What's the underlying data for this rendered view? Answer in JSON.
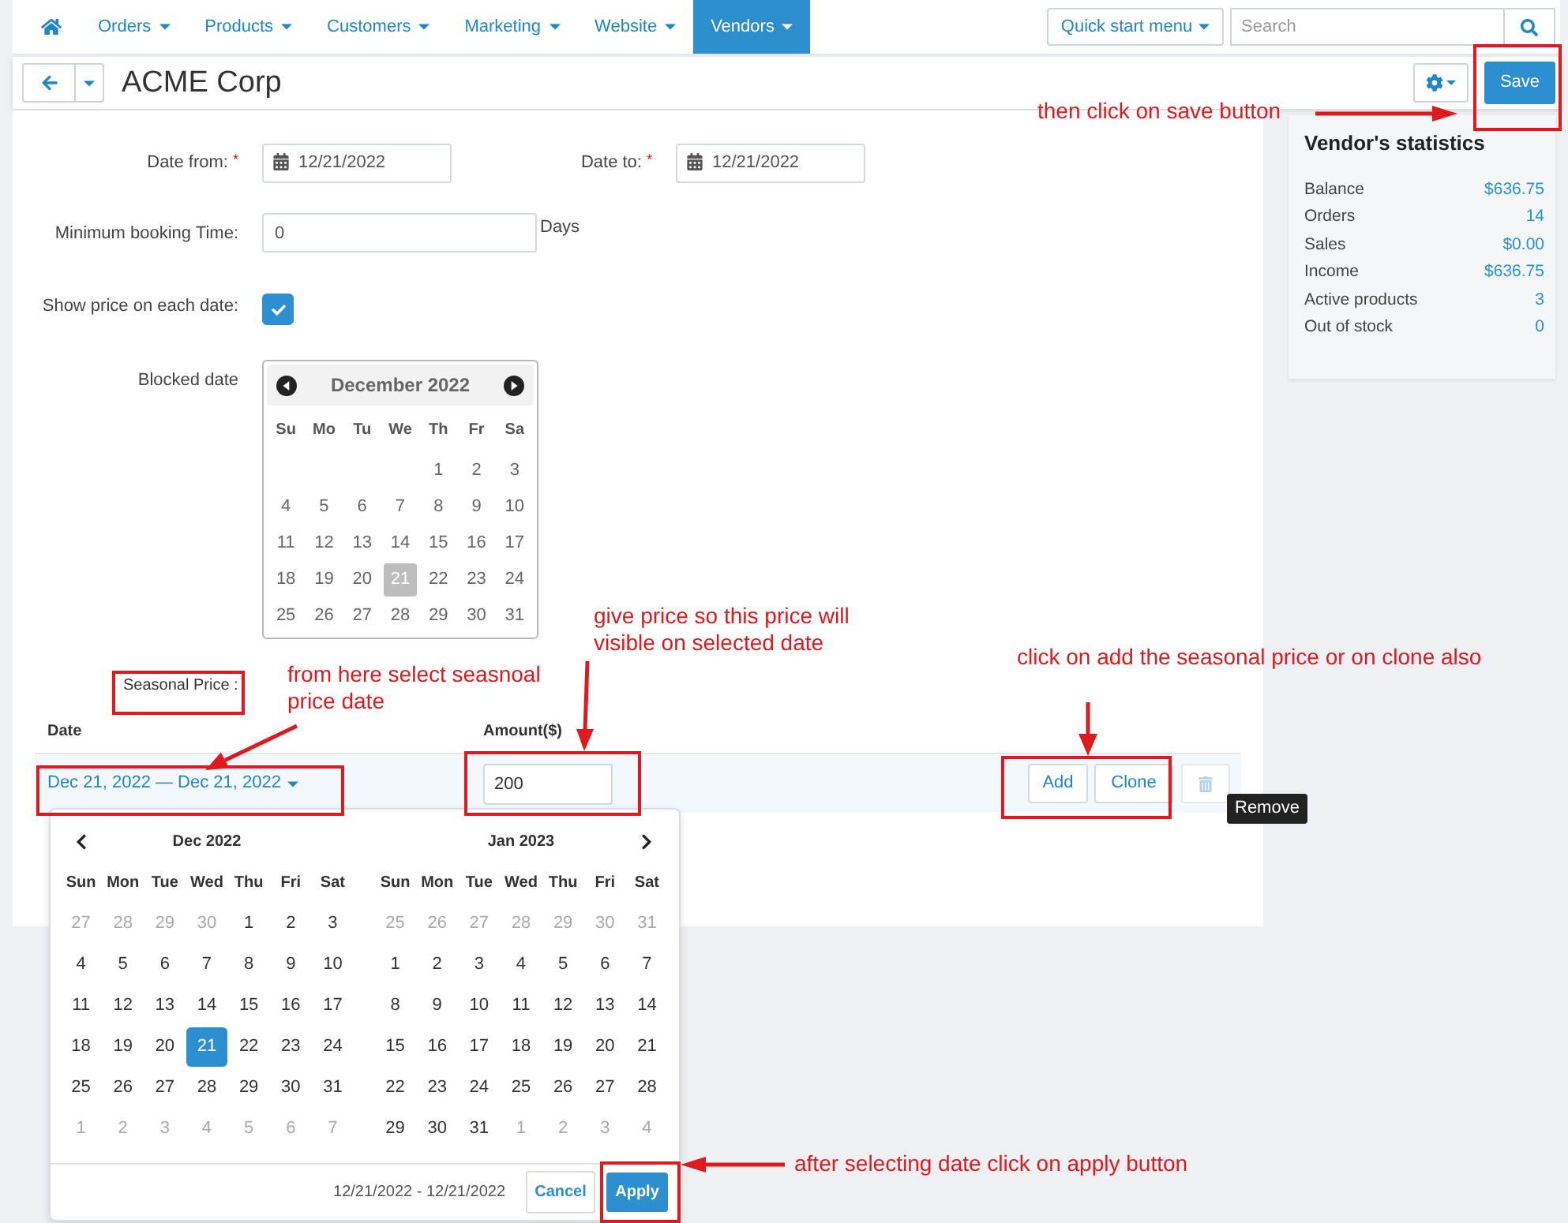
{
  "top_nav": {
    "items": [
      {
        "label": "Orders",
        "selected": false
      },
      {
        "label": "Products",
        "selected": false
      },
      {
        "label": "Customers",
        "selected": false
      },
      {
        "label": "Marketing",
        "selected": false
      },
      {
        "label": "Website",
        "selected": false
      },
      {
        "label": "Vendors",
        "selected": true
      }
    ],
    "quick_start": "Quick start menu",
    "search": {
      "placeholder": "Search"
    }
  },
  "toolbar": {
    "title": "ACME Corp",
    "save_button": "Save"
  },
  "form": {
    "date_from": {
      "label": "Date from:",
      "required_mark": "*",
      "value": "12/21/2022"
    },
    "date_to": {
      "label": "Date to:",
      "required_mark": "*",
      "value": "12/21/2022"
    },
    "min_booking": {
      "label": "Minimum booking Time:",
      "value": "0",
      "unit": "Days"
    },
    "show_price": {
      "label": "Show price on each date:",
      "checked": true
    },
    "blocked_date": {
      "label": "Blocked date",
      "calendar": {
        "title": "December 2022",
        "weekdays": [
          "Su",
          "Mo",
          "Tu",
          "We",
          "Th",
          "Fr",
          "Sa"
        ],
        "weeks": [
          [
            {
              "day": "1",
              "selected": false
            },
            {
              "day": "2",
              "selected": false
            },
            {
              "day": "3",
              "selected": false
            }
          ],
          [
            {
              "day": "4",
              "selected": false
            },
            {
              "day": "5",
              "selected": false
            },
            {
              "day": "6",
              "selected": false
            },
            {
              "day": "7",
              "selected": false
            },
            {
              "day": "8",
              "selected": false
            },
            {
              "day": "9",
              "selected": false
            },
            {
              "day": "10",
              "selected": false
            }
          ],
          [
            {
              "day": "11",
              "selected": false
            },
            {
              "day": "12",
              "selected": false
            },
            {
              "day": "13",
              "selected": false
            },
            {
              "day": "14",
              "selected": false
            },
            {
              "day": "15",
              "selected": false
            },
            {
              "day": "16",
              "selected": false
            },
            {
              "day": "17",
              "selected": false
            }
          ],
          [
            {
              "day": "18",
              "selected": false
            },
            {
              "day": "19",
              "selected": false
            },
            {
              "day": "20",
              "selected": false
            },
            {
              "day": "21",
              "selected": true
            },
            {
              "day": "22",
              "selected": false
            },
            {
              "day": "23",
              "selected": false
            },
            {
              "day": "24",
              "selected": false
            }
          ],
          [
            {
              "day": "25",
              "selected": false
            },
            {
              "day": "26",
              "selected": false
            },
            {
              "day": "27",
              "selected": false
            },
            {
              "day": "28",
              "selected": false
            },
            {
              "day": "29",
              "selected": false
            },
            {
              "day": "30",
              "selected": false
            },
            {
              "day": "31",
              "selected": false
            }
          ]
        ]
      }
    }
  },
  "stats": {
    "title": "Vendor's statistics",
    "rows": [
      {
        "label": "Balance",
        "value": "$636.75"
      },
      {
        "label": "Orders",
        "value": "14"
      },
      {
        "label": "Sales",
        "value": "$0.00"
      },
      {
        "label": "Income",
        "value": "$636.75"
      },
      {
        "label": "Active products",
        "value": "3"
      },
      {
        "label": "Out of stock",
        "value": "0"
      }
    ]
  },
  "seasonal_price": {
    "label": "Seasonal Price :",
    "columns": [
      "Date",
      "Amount($)"
    ],
    "rows": [
      {
        "date_range": "Dec 21, 2022 — Dec 21, 2022",
        "amount": "200",
        "buttons": [
          "Add",
          "Clone"
        ],
        "remove_tooltip": "Remove"
      }
    ]
  },
  "date_range_picker": {
    "months": [
      {
        "title": "Dec 2022",
        "weekdays": [
          "Sun",
          "Mon",
          "Tue",
          "Wed",
          "Thu",
          "Fri",
          "Sat"
        ],
        "weeks": [
          [
            {
              "day": "27",
              "muted": true,
              "selected": false
            },
            {
              "day": "28",
              "muted": true,
              "selected": false
            },
            {
              "day": "29",
              "muted": true,
              "selected": false
            },
            {
              "day": "30",
              "muted": true,
              "selected": false
            },
            {
              "day": "1",
              "muted": false,
              "selected": false
            },
            {
              "day": "2",
              "muted": false,
              "selected": false
            },
            {
              "day": "3",
              "muted": false,
              "selected": false
            }
          ],
          [
            {
              "day": "4",
              "muted": false,
              "selected": false
            },
            {
              "day": "5",
              "muted": false,
              "selected": false
            },
            {
              "day": "6",
              "muted": false,
              "selected": false
            },
            {
              "day": "7",
              "muted": false,
              "selected": false
            },
            {
              "day": "8",
              "muted": false,
              "selected": false
            },
            {
              "day": "9",
              "muted": false,
              "selected": false
            },
            {
              "day": "10",
              "muted": false,
              "selected": false
            }
          ],
          [
            {
              "day": "11",
              "muted": false,
              "selected": false
            },
            {
              "day": "12",
              "muted": false,
              "selected": false
            },
            {
              "day": "13",
              "muted": false,
              "selected": false
            },
            {
              "day": "14",
              "muted": false,
              "selected": false
            },
            {
              "day": "15",
              "muted": false,
              "selected": false
            },
            {
              "day": "16",
              "muted": false,
              "selected": false
            },
            {
              "day": "17",
              "muted": false,
              "selected": false
            }
          ],
          [
            {
              "day": "18",
              "muted": false,
              "selected": false
            },
            {
              "day": "19",
              "muted": false,
              "selected": false
            },
            {
              "day": "20",
              "muted": false,
              "selected": false
            },
            {
              "day": "21",
              "muted": false,
              "selected": true
            },
            {
              "day": "22",
              "muted": false,
              "selected": false
            },
            {
              "day": "23",
              "muted": false,
              "selected": false
            },
            {
              "day": "24",
              "muted": false,
              "selected": false
            }
          ],
          [
            {
              "day": "25",
              "muted": false,
              "selected": false
            },
            {
              "day": "26",
              "muted": false,
              "selected": false
            },
            {
              "day": "27",
              "muted": false,
              "selected": false
            },
            {
              "day": "28",
              "muted": false,
              "selected": false
            },
            {
              "day": "29",
              "muted": false,
              "selected": false
            },
            {
              "day": "30",
              "muted": false,
              "selected": false
            },
            {
              "day": "31",
              "muted": false,
              "selected": false
            }
          ],
          [
            {
              "day": "1",
              "muted": true,
              "selected": false
            },
            {
              "day": "2",
              "muted": true,
              "selected": false
            },
            {
              "day": "3",
              "muted": true,
              "selected": false
            },
            {
              "day": "4",
              "muted": true,
              "selected": false
            },
            {
              "day": "5",
              "muted": true,
              "selected": false
            },
            {
              "day": "6",
              "muted": true,
              "selected": false
            },
            {
              "day": "7",
              "muted": true,
              "selected": false
            }
          ]
        ]
      },
      {
        "title": "Jan 2023",
        "weekdays": [
          "Sun",
          "Mon",
          "Tue",
          "Wed",
          "Thu",
          "Fri",
          "Sat"
        ],
        "weeks": [
          [
            {
              "day": "25",
              "muted": true,
              "selected": false
            },
            {
              "day": "26",
              "muted": true,
              "selected": false
            },
            {
              "day": "27",
              "muted": true,
              "selected": false
            },
            {
              "day": "28",
              "muted": true,
              "selected": false
            },
            {
              "day": "29",
              "muted": true,
              "selected": false
            },
            {
              "day": "30",
              "muted": true,
              "selected": false
            },
            {
              "day": "31",
              "muted": true,
              "selected": false
            }
          ],
          [
            {
              "day": "1",
              "muted": false,
              "selected": false
            },
            {
              "day": "2",
              "muted": false,
              "selected": false
            },
            {
              "day": "3",
              "muted": false,
              "selected": false
            },
            {
              "day": "4",
              "muted": false,
              "selected": false
            },
            {
              "day": "5",
              "muted": false,
              "selected": false
            },
            {
              "day": "6",
              "muted": false,
              "selected": false
            },
            {
              "day": "7",
              "muted": false,
              "selected": false
            }
          ],
          [
            {
              "day": "8",
              "muted": false,
              "selected": false
            },
            {
              "day": "9",
              "muted": false,
              "selected": false
            },
            {
              "day": "10",
              "muted": false,
              "selected": false
            },
            {
              "day": "11",
              "muted": false,
              "selected": false
            },
            {
              "day": "12",
              "muted": false,
              "selected": false
            },
            {
              "day": "13",
              "muted": false,
              "selected": false
            },
            {
              "day": "14",
              "muted": false,
              "selected": false
            }
          ],
          [
            {
              "day": "15",
              "muted": false,
              "selected": false
            },
            {
              "day": "16",
              "muted": false,
              "selected": false
            },
            {
              "day": "17",
              "muted": false,
              "selected": false
            },
            {
              "day": "18",
              "muted": false,
              "selected": false
            },
            {
              "day": "19",
              "muted": false,
              "selected": false
            },
            {
              "day": "20",
              "muted": false,
              "selected": false
            },
            {
              "day": "21",
              "muted": false,
              "selected": false
            }
          ],
          [
            {
              "day": "22",
              "muted": false,
              "selected": false
            },
            {
              "day": "23",
              "muted": false,
              "selected": false
            },
            {
              "day": "24",
              "muted": false,
              "selected": false
            },
            {
              "day": "25",
              "muted": false,
              "selected": false
            },
            {
              "day": "26",
              "muted": false,
              "selected": false
            },
            {
              "day": "27",
              "muted": false,
              "selected": false
            },
            {
              "day": "28",
              "muted": false,
              "selected": false
            }
          ],
          [
            {
              "day": "29",
              "muted": false,
              "selected": false
            },
            {
              "day": "30",
              "muted": false,
              "selected": false
            },
            {
              "day": "31",
              "muted": false,
              "selected": false
            },
            {
              "day": "1",
              "muted": true,
              "selected": false
            },
            {
              "day": "2",
              "muted": true,
              "selected": false
            },
            {
              "day": "3",
              "muted": true,
              "selected": false
            },
            {
              "day": "4",
              "muted": true,
              "selected": false
            }
          ]
        ]
      }
    ],
    "range_text": "12/21/2022 - 12/21/2022",
    "cancel": "Cancel",
    "apply": "Apply"
  },
  "annotations": [
    "then click on save button",
    "give price so this price will visible on selected date",
    "from here select seasnoal price date",
    "click on add the seasonal price or on clone also",
    "after selecting date click on apply button"
  ]
}
